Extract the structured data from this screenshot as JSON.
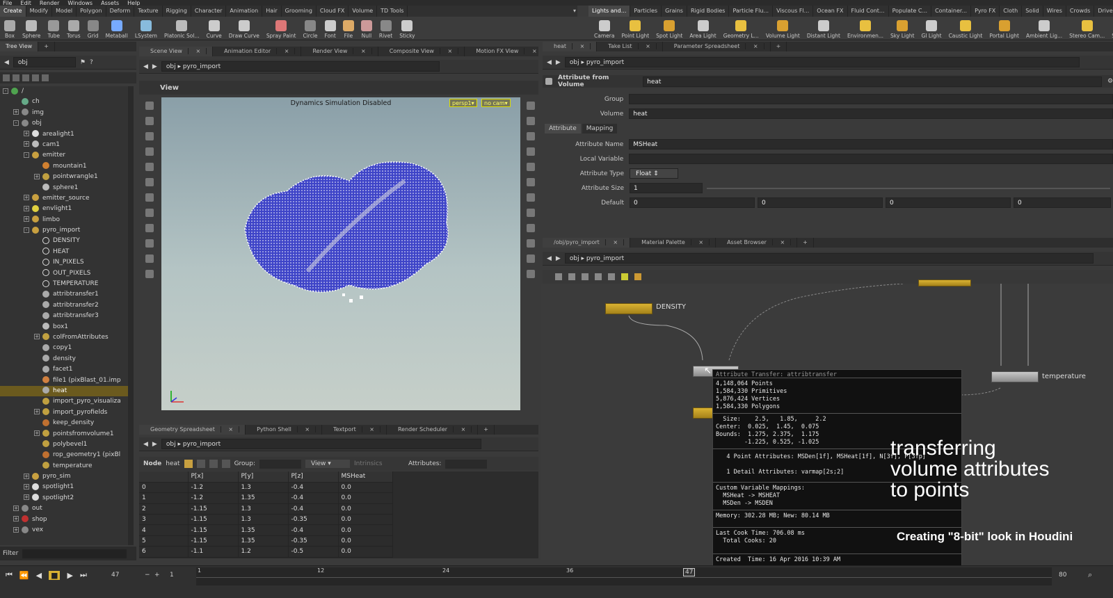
{
  "menu": [
    "File",
    "Edit",
    "Render",
    "Windows",
    "Assets",
    "Help"
  ],
  "shelf_tabs_left": [
    "Create",
    "Modify",
    "Model",
    "Polygon",
    "Deform",
    "Texture",
    "Rigging",
    "Character",
    "Animation",
    "Hair",
    "Grooming",
    "Cloud FX",
    "Volume",
    "TD Tools"
  ],
  "shelf_tabs_right": [
    "Lights and...",
    "Particles",
    "Grains",
    "Rigid Bodies",
    "Particle Flu...",
    "Viscous Fl...",
    "Ocean FX",
    "Fluid Cont...",
    "Populate C...",
    "Container...",
    "Pyro FX",
    "Cloth",
    "Solid",
    "Wires",
    "Crowds",
    "Drive"
  ],
  "tools_left": [
    "Box",
    "Sphere",
    "Tube",
    "Torus",
    "Grid",
    "Metaball",
    "LSystem",
    "Platonic Sol...",
    "Curve",
    "Draw Curve",
    "Spray Paint",
    "Circle",
    "Font",
    "File",
    "Null",
    "Rivet",
    "Sticky"
  ],
  "tools_right": [
    "Camera",
    "Point Light",
    "Spot Light",
    "Area Light",
    "Geometry L...",
    "Volume Light",
    "Distant Light",
    "Environmen...",
    "Sky Light",
    "GI Light",
    "Caustic Light",
    "Portal Light",
    "Ambient Lig...",
    "Stereo Cam...",
    "Switcher"
  ],
  "tree_panel": {
    "tab": "Tree View",
    "path": "obj"
  },
  "tree": [
    {
      "label": "/",
      "indent": 0,
      "exp": "-",
      "color": "#4fa34f"
    },
    {
      "label": "ch",
      "indent": 1,
      "exp": "",
      "color": "#6a8"
    },
    {
      "label": "img",
      "indent": 1,
      "exp": "+",
      "color": "#888"
    },
    {
      "label": "obj",
      "indent": 1,
      "exp": "-",
      "color": "#888"
    },
    {
      "label": "arealight1",
      "indent": 2,
      "exp": "+",
      "color": "#ddd"
    },
    {
      "label": "cam1",
      "indent": 2,
      "exp": "+",
      "color": "#bbb"
    },
    {
      "label": "emitter",
      "indent": 2,
      "exp": "-",
      "color": "#c8a040"
    },
    {
      "label": "mountain1",
      "indent": 3,
      "exp": "",
      "color": "#d08030"
    },
    {
      "label": "pointwrangle1",
      "indent": 3,
      "exp": "+",
      "color": "#c0a040"
    },
    {
      "label": "sphere1",
      "indent": 3,
      "exp": "",
      "color": "#bbb"
    },
    {
      "label": "emitter_source",
      "indent": 2,
      "exp": "+",
      "color": "#c8a040"
    },
    {
      "label": "envlight1",
      "indent": 2,
      "exp": "+",
      "color": "#e0d040"
    },
    {
      "label": "limbo",
      "indent": 2,
      "exp": "+",
      "color": "#c8a040"
    },
    {
      "label": "pyro_import",
      "indent": 2,
      "exp": "-",
      "color": "#c8a040"
    },
    {
      "label": "DENSITY",
      "indent": 3,
      "exp": "",
      "color": "none"
    },
    {
      "label": "HEAT",
      "indent": 3,
      "exp": "",
      "color": "none"
    },
    {
      "label": "IN_PIXELS",
      "indent": 3,
      "exp": "",
      "color": "none"
    },
    {
      "label": "OUT_PIXELS",
      "indent": 3,
      "exp": "",
      "color": "none"
    },
    {
      "label": "TEMPERATURE",
      "indent": 3,
      "exp": "",
      "color": "none"
    },
    {
      "label": "attribtransfer1",
      "indent": 3,
      "exp": "",
      "color": "#aaa"
    },
    {
      "label": "attribtransfer2",
      "indent": 3,
      "exp": "",
      "color": "#aaa"
    },
    {
      "label": "attribtransfer3",
      "indent": 3,
      "exp": "",
      "color": "#aaa"
    },
    {
      "label": "box1",
      "indent": 3,
      "exp": "",
      "color": "#bbb"
    },
    {
      "label": "colFromAttributes",
      "indent": 3,
      "exp": "+",
      "color": "#c0a040"
    },
    {
      "label": "copy1",
      "indent": 3,
      "exp": "",
      "color": "#aaa"
    },
    {
      "label": "density",
      "indent": 3,
      "exp": "",
      "color": "#aaa"
    },
    {
      "label": "facet1",
      "indent": 3,
      "exp": "",
      "color": "#aaa"
    },
    {
      "label": "file1 (pixBlast_01.imp",
      "indent": 3,
      "exp": "",
      "color": "#d08040"
    },
    {
      "label": "heat",
      "indent": 3,
      "exp": "",
      "color": "#aaa",
      "selected": true
    },
    {
      "label": "import_pyro_visualiza",
      "indent": 3,
      "exp": "",
      "color": "#c0a040"
    },
    {
      "label": "import_pyrofields",
      "indent": 3,
      "exp": "+",
      "color": "#c0a040"
    },
    {
      "label": "keep_density",
      "indent": 3,
      "exp": "",
      "color": "#c07030"
    },
    {
      "label": "pointsfromvolume1",
      "indent": 3,
      "exp": "+",
      "color": "#c0a040"
    },
    {
      "label": "polybevel1",
      "indent": 3,
      "exp": "",
      "color": "#c0a040"
    },
    {
      "label": "rop_geometry1 (pixBl",
      "indent": 3,
      "exp": "",
      "color": "#c07030"
    },
    {
      "label": "temperature",
      "indent": 3,
      "exp": "",
      "color": "#c0a040"
    },
    {
      "label": "pyro_sim",
      "indent": 2,
      "exp": "+",
      "color": "#c8a040"
    },
    {
      "label": "spotlight1",
      "indent": 2,
      "exp": "+",
      "color": "#ddd"
    },
    {
      "label": "spotlight2",
      "indent": 2,
      "exp": "+",
      "color": "#ddd"
    },
    {
      "label": "out",
      "indent": 1,
      "exp": "+",
      "color": "#888"
    },
    {
      "label": "shop",
      "indent": 1,
      "exp": "+",
      "color": "#c03030"
    },
    {
      "label": "vex",
      "indent": 1,
      "exp": "+",
      "color": "#888"
    }
  ],
  "tree_filter": "Filter",
  "scene_tabs": [
    "Scene View",
    "Animation Editor",
    "Render View",
    "Composite View",
    "Motion FX View"
  ],
  "scene_path": {
    "root": "obj",
    "node": "pyro_import"
  },
  "view_label": "View",
  "viewport_msg": "Dynamics Simulation Disabled",
  "persp_btn": "persp1",
  "cam_btn": "no cam",
  "param_tabs": [
    "heat",
    "Take List",
    "Parameter Spreadsheet"
  ],
  "param_path": {
    "root": "obj",
    "node": "pyro_import"
  },
  "param_header": {
    "type": "Attribute from Volume",
    "name": "heat"
  },
  "params": {
    "group_label": "Group",
    "group_value": "",
    "volume_label": "Volume",
    "volume_value": "heat",
    "subtabs": [
      "Attribute",
      "Mapping"
    ],
    "attr_name_label": "Attribute Name",
    "attr_name_value": "MSHeat",
    "local_var_label": "Local Variable",
    "local_var_value": "",
    "attr_type_label": "Attribute Type",
    "attr_type_value": "Float",
    "attr_size_label": "Attribute Size",
    "attr_size_value": "1",
    "default_label": "Default",
    "default_values": [
      "0",
      "0",
      "0",
      "0"
    ]
  },
  "net_tabs": [
    "/obj/pyro_import",
    "Material Palette",
    "Asset Browser"
  ],
  "net_path": {
    "root": "obj",
    "node": "pyro_import"
  },
  "nodes": {
    "density": "DENSITY",
    "temperature": "temperature",
    "partial_label": "attribtransfer"
  },
  "info_popup": {
    "header": "Attribute Transfer: attribtransfer",
    "counts": [
      "4,148,064 Points",
      "1,584,330 Primitives",
      "5,876,424 Vertices",
      "1,584,330 Polygons"
    ],
    "bounds": "  Size:    2.5,   1.85,     2.2\nCenter:  0.025,  1.45,  0.075\nBounds:  1.275, 2.375,  1.175\n        -1.225, 0.525, -1.025",
    "attrs": "   4 Point Attributes: MSDen[1f], MSHeat[1f], N[3f], P[3fp]\n\n   1 Detail Attributes: varmap[2s;2]",
    "mappings": "Custom Variable Mappings:\n  MSHeat -> MSHEAT\n  MSDen -> MSDEN",
    "memory": "Memory: 302.28 MB; New: 80.14 MB",
    "cook": "Last Cook Time: 706.08 ms\n  Total Cooks: 20",
    "created": "Created  Time: 16 Apr 2016 10:39 AM"
  },
  "overlay": {
    "line1": "transferring",
    "line2": "volume attributes",
    "line3": "to points",
    "subtitle": "Creating \"8-bit\" look in Houdini"
  },
  "spread_tabs": [
    "Geometry Spreadsheet",
    "Python Shell",
    "Textport",
    "Render Scheduler"
  ],
  "spread_path": {
    "root": "obj",
    "node": "pyro_import"
  },
  "spread_toolbar": {
    "node_label": "Node",
    "node_value": "heat",
    "group_label": "Group:",
    "view": "View",
    "intrinsics": "Intrinsics",
    "attributes": "Attributes:"
  },
  "spread_cols": [
    "",
    "P[x]",
    "P[y]",
    "P[z]",
    "MSHeat"
  ],
  "spread_rows": [
    [
      "0",
      "-1.2",
      "1.3",
      "-0.4",
      "0.0"
    ],
    [
      "1",
      "-1.2",
      "1.35",
      "-0.4",
      "0.0"
    ],
    [
      "2",
      "-1.15",
      "1.3",
      "-0.4",
      "0.0"
    ],
    [
      "3",
      "-1.15",
      "1.3",
      "-0.35",
      "0.0"
    ],
    [
      "4",
      "-1.15",
      "1.35",
      "-0.4",
      "0.0"
    ],
    [
      "5",
      "-1.15",
      "1.35",
      "-0.35",
      "0.0"
    ],
    [
      "6",
      "-1.1",
      "1.2",
      "-0.5",
      "0.0"
    ]
  ],
  "timeline": {
    "frame": "47",
    "start": "1",
    "end": "80",
    "ticks": [
      "1",
      "12",
      "24",
      "36"
    ],
    "current_marker": "47"
  },
  "colors": {
    "accent": "#c8a040",
    "selection": "#6b5a1e",
    "points": "#3e44c8"
  }
}
